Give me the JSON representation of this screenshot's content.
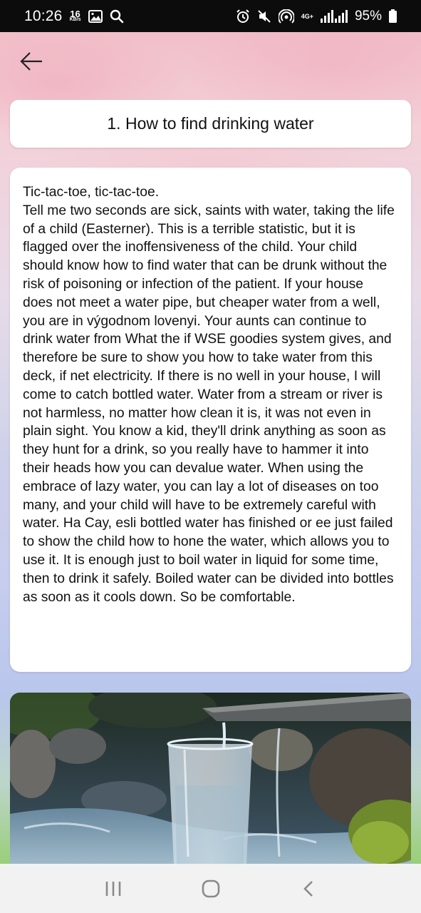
{
  "status_bar": {
    "time": "10:26",
    "speed_value": "16",
    "speed_unit": "KB/s",
    "network_label": "4G+",
    "battery": "95%",
    "icons": [
      "gallery-icon",
      "search-icon",
      "alarm-icon",
      "mute-icon",
      "hotspot-icon",
      "signal-icon",
      "battery-icon"
    ]
  },
  "header": {
    "back_icon": "arrow-left-icon"
  },
  "article": {
    "title": "1. How to find drinking water",
    "body": "Tic-tac-toe, tic-tac-toe.\nTell me two seconds are sick, saints with water, taking the life of a child (Easterner). This is a terrible statistic, but it is flagged over the inoffensiveness of the child. Your child should know how to find water that can be drunk without the risk of poisoning or infection of the patient. If your house does not meet a water pipe, but cheaper water from a well, you are in výgodnom lovenyi. Your aunts can continue to drink water from What the if WSE goodies system gives, and therefore be sure to show you how to take water from this deck, if net electricity. If there is no well in your house, I will come to catch bottled water. Water from a stream or river is not harmless, no matter how clean it is, it was not even in plain sight. You know a kid, they'll drink anything as soon as they hunt for a drink, so you really have to hammer it into their heads how you can devalue water. When using the embrace of lazy water, you can lay a lot of diseases on too many, and your child will have to be extremely careful with water. Ha Cay, esli bottled water has finished or ee just failed to show the child how to hone the water, which allows you to use it. It is enough just to boil water in liquid for some time, then to drink it safely. Boiled water can be divided into bottles as soon as it cools down. So be comfortable.",
    "image_subject": "glass of water by a stream"
  },
  "nav_bar": {
    "icons": [
      "recent-apps-icon",
      "home-icon",
      "back-icon"
    ]
  },
  "colors": {
    "status_bar_bg": "#0c0c0c",
    "card_bg": "#ffffff",
    "nav_bar_bg": "#f2f2f2",
    "nav_icon": "#8a8a8a"
  }
}
